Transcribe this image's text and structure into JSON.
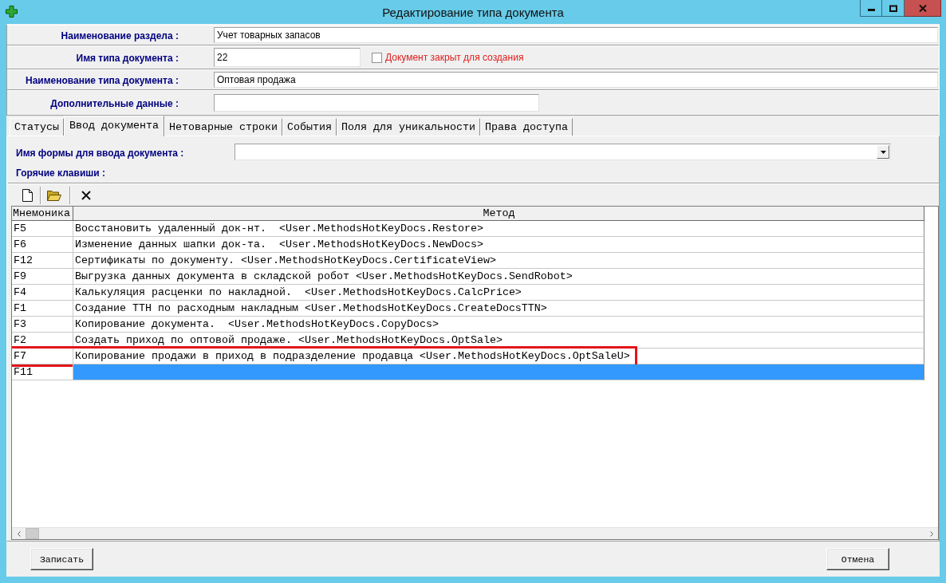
{
  "window": {
    "title": "Редактирование типа документа"
  },
  "header_form": {
    "rows": [
      {
        "kind": "wide",
        "label": "Наименование раздела :",
        "value": "Учет товарных запасов"
      },
      {
        "kind": "short",
        "label": "Имя типа документа :",
        "value": "22",
        "checkbox": {
          "label": "Документ закрыт для создания",
          "checked": false
        }
      },
      {
        "kind": "wide",
        "label": "Наименование типа документа :",
        "value": "Оптовая продажа"
      },
      {
        "kind": "medium",
        "label": "Дополнительные данные :"
      }
    ]
  },
  "tabs": [
    {
      "label": "Статусы",
      "selected": false
    },
    {
      "label": "Ввод документа",
      "selected": true
    },
    {
      "label": "Нетоварные строки",
      "selected": false
    },
    {
      "label": "События",
      "selected": false
    },
    {
      "label": "Поля для уникальности",
      "selected": false
    },
    {
      "label": "Права доступа",
      "selected": false
    }
  ],
  "tab_panel": {
    "form_name": {
      "label": "Имя формы для ввода документа :"
    },
    "hotkeys_label": "Горячие клавиши :"
  },
  "hotkeys_table": {
    "columns": [
      "Мнемоника",
      "Метод"
    ],
    "rows": [
      {
        "key": "F5",
        "method": "Восстановить удаленный док-нт.  <User.MethodsHotKeyDocs.Restore>",
        "selected": false,
        "highlighted": false
      },
      {
        "key": "F6",
        "method": "Изменение данных шапки док-та.  <User.MethodsHotKeyDocs.NewDocs>",
        "selected": false,
        "highlighted": false
      },
      {
        "key": "F12",
        "method": "Сертификаты по документу. <User.MethodsHotKeyDocs.CertificateView>",
        "selected": false,
        "highlighted": false
      },
      {
        "key": "F9",
        "method": "Выгрузка данных документа в складской робот <User.MethodsHotKeyDocs.SendRobot>",
        "selected": false,
        "highlighted": false
      },
      {
        "key": "F4",
        "method": "Калькуляция расценки по накладной.  <User.MethodsHotKeyDocs.CalcPrice>",
        "selected": false,
        "highlighted": false
      },
      {
        "key": "F1",
        "method": "Создание ТТН по расходным накладным <User.MethodsHotKeyDocs.CreateDocsTTN>",
        "selected": false,
        "highlighted": false
      },
      {
        "key": "F3",
        "method": "Копирование документа.  <User.MethodsHotKeyDocs.CopyDocs>",
        "selected": false,
        "highlighted": false
      },
      {
        "key": "F2",
        "method": "Создать приход по оптовой продаже. <User.MethodsHotKeyDocs.OptSale>",
        "selected": false,
        "highlighted": false
      },
      {
        "key": "F7",
        "method": "Копирование продажи в приход в подразделение продавца <User.MethodsHotKeyDocs.OptSaleU>",
        "selected": false,
        "highlighted": true
      },
      {
        "key": "F11",
        "selected": true,
        "highlighted": false
      }
    ]
  },
  "buttons": [
    "Записать",
    "Отмена"
  ]
}
